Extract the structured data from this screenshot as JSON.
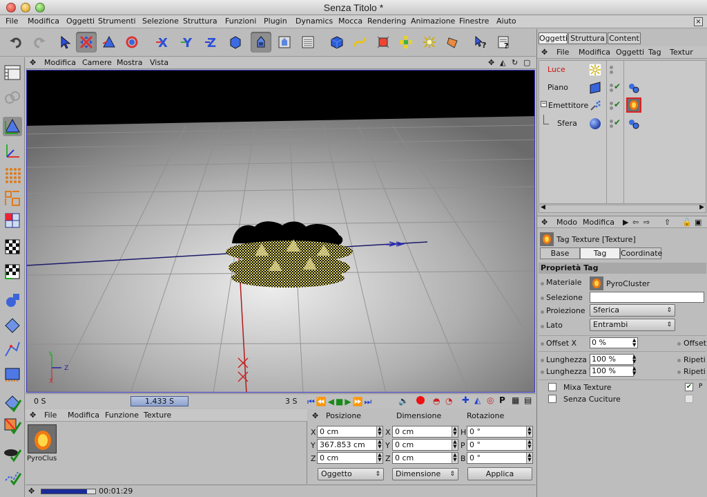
{
  "window": {
    "title": "Senza Titolo *"
  },
  "menubar": [
    "File",
    "Modifica",
    "Oggetti",
    "Strumenti",
    "Selezione",
    "Struttura",
    "Funzioni",
    "Plugin",
    "Dynamics",
    "Mocca",
    "Rendering",
    "Animazione",
    "Finestre",
    "Aiuto"
  ],
  "viewport": {
    "menu": [
      "Modifica",
      "Camere",
      "Mostra",
      "Vista"
    ],
    "axes": {
      "x": "X",
      "y": "Y",
      "z": "Z"
    }
  },
  "timeline": {
    "start": "0 S",
    "current": "1.433 S",
    "end": "3 S"
  },
  "material_manager": {
    "menu": [
      "File",
      "Modifica",
      "Funzione",
      "Texture"
    ],
    "material_name": "PyroClus"
  },
  "coordinates": {
    "headers": {
      "pos": "Posizione",
      "dim": "Dimensione",
      "rot": "Rotazione"
    },
    "pos": [
      {
        "axis": "X",
        "value": "0 cm"
      },
      {
        "axis": "Y",
        "value": "367.853 cm"
      },
      {
        "axis": "Z",
        "value": "0 cm"
      }
    ],
    "dim": [
      {
        "axis": "X",
        "value": "0 cm"
      },
      {
        "axis": "Y",
        "value": "0 cm"
      },
      {
        "axis": "Z",
        "value": "0 cm"
      }
    ],
    "rot": [
      {
        "axis": "H",
        "value": "0 °"
      },
      {
        "axis": "P",
        "value": "0 °"
      },
      {
        "axis": "B",
        "value": "0 °"
      }
    ],
    "mode_select": "Oggetto",
    "dim_select": "Dimensione",
    "apply": "Applica"
  },
  "status": {
    "time": "00:01:29",
    "progress": 0.85
  },
  "right_tabs": [
    "Oggetti",
    "Struttura",
    "Content"
  ],
  "obj_menu": [
    "File",
    "Modifica",
    "Oggetti",
    "Tag",
    "Textur"
  ],
  "objects": [
    {
      "name": "Luce",
      "color": "#cc1111"
    },
    {
      "name": "Piano",
      "color": "#111111"
    },
    {
      "name": "Emettitore",
      "color": "#111111"
    },
    {
      "name": "Sfera",
      "color": "#111111"
    }
  ],
  "attr": {
    "menu": [
      "Modo",
      "Modifica"
    ],
    "title": "Tag Texture [Texture]",
    "tabs": [
      "Base",
      "Tag",
      "Coordinate"
    ],
    "section": "Proprietà Tag",
    "material_label": "Materiale",
    "material_value": "PyroCluster",
    "selection_label": "Selezione",
    "projection_label": "Proiezione",
    "projection_value": "Sferica",
    "side_label": "Lato",
    "side_value": "Entrambi",
    "offset_x_label": "Offset X",
    "offset_x_value": "0 %",
    "offset_label": "Offset",
    "length_x_label": "Lunghezza X",
    "length_x_value": "100 %",
    "length_y_label": "Lunghezza Y",
    "length_y_value": "100 %",
    "repeat_label_1": "Ripeti",
    "repeat_label_2": "Ripeti",
    "mix_label": "Mixa Texture",
    "seamless_label": "Senza Cuciture",
    "small_p": "P"
  }
}
